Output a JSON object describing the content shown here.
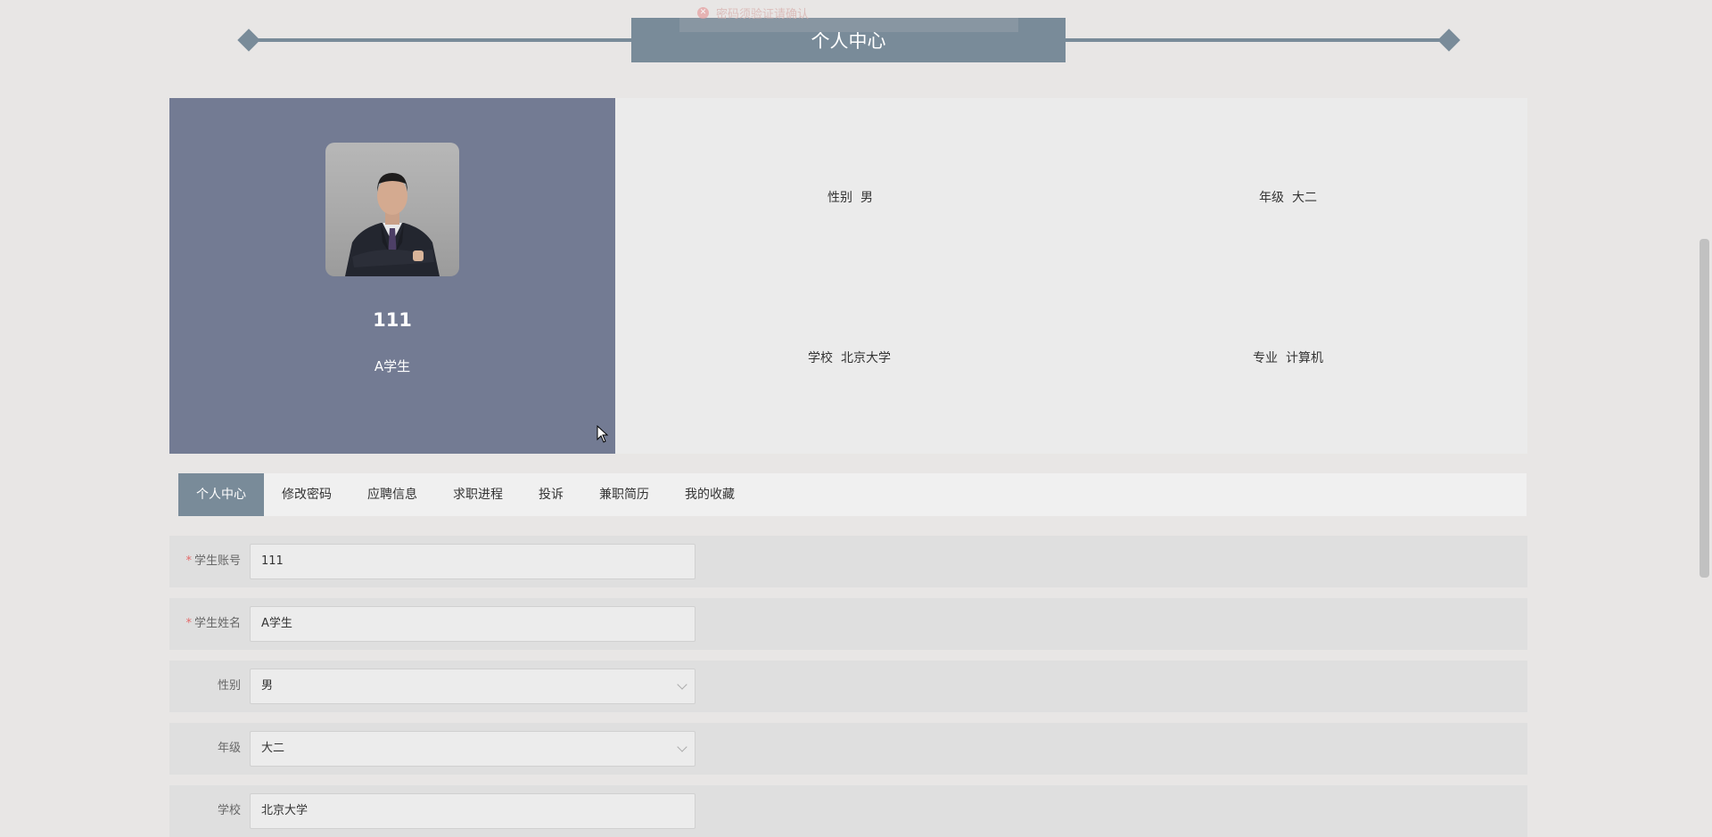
{
  "toast": {
    "text": "密码须验证请确认"
  },
  "page_title": "个人中心",
  "profile": {
    "name": "111",
    "role": "A学生",
    "avatar_alt": "avatar",
    "info": [
      {
        "label": "性别",
        "value": "男"
      },
      {
        "label": "年级",
        "value": "大二"
      },
      {
        "label": "学校",
        "value": "北京大学"
      },
      {
        "label": "专业",
        "value": "计算机"
      }
    ]
  },
  "tabs": [
    {
      "label": "个人中心",
      "active": true
    },
    {
      "label": "修改密码",
      "active": false
    },
    {
      "label": "应聘信息",
      "active": false
    },
    {
      "label": "求职进程",
      "active": false
    },
    {
      "label": "投诉",
      "active": false
    },
    {
      "label": "兼职简历",
      "active": false
    },
    {
      "label": "我的收藏",
      "active": false
    }
  ],
  "form": {
    "required_mark": "*",
    "fields": [
      {
        "label": "学生账号",
        "value": "111",
        "required": true,
        "type": "text"
      },
      {
        "label": "学生姓名",
        "value": "A学生",
        "required": true,
        "type": "text"
      },
      {
        "label": "性别",
        "value": "男",
        "required": false,
        "type": "select"
      },
      {
        "label": "年级",
        "value": "大二",
        "required": false,
        "type": "select"
      },
      {
        "label": "学校",
        "value": "北京大学",
        "required": false,
        "type": "text"
      }
    ]
  },
  "colors": {
    "accent": "#798b99",
    "profile_panel": "#737b93",
    "required": "#e36b6b"
  },
  "icons": {
    "toast": "error-circle-icon",
    "select": "chevron-down-icon",
    "cursor": "mouse-pointer-icon"
  }
}
